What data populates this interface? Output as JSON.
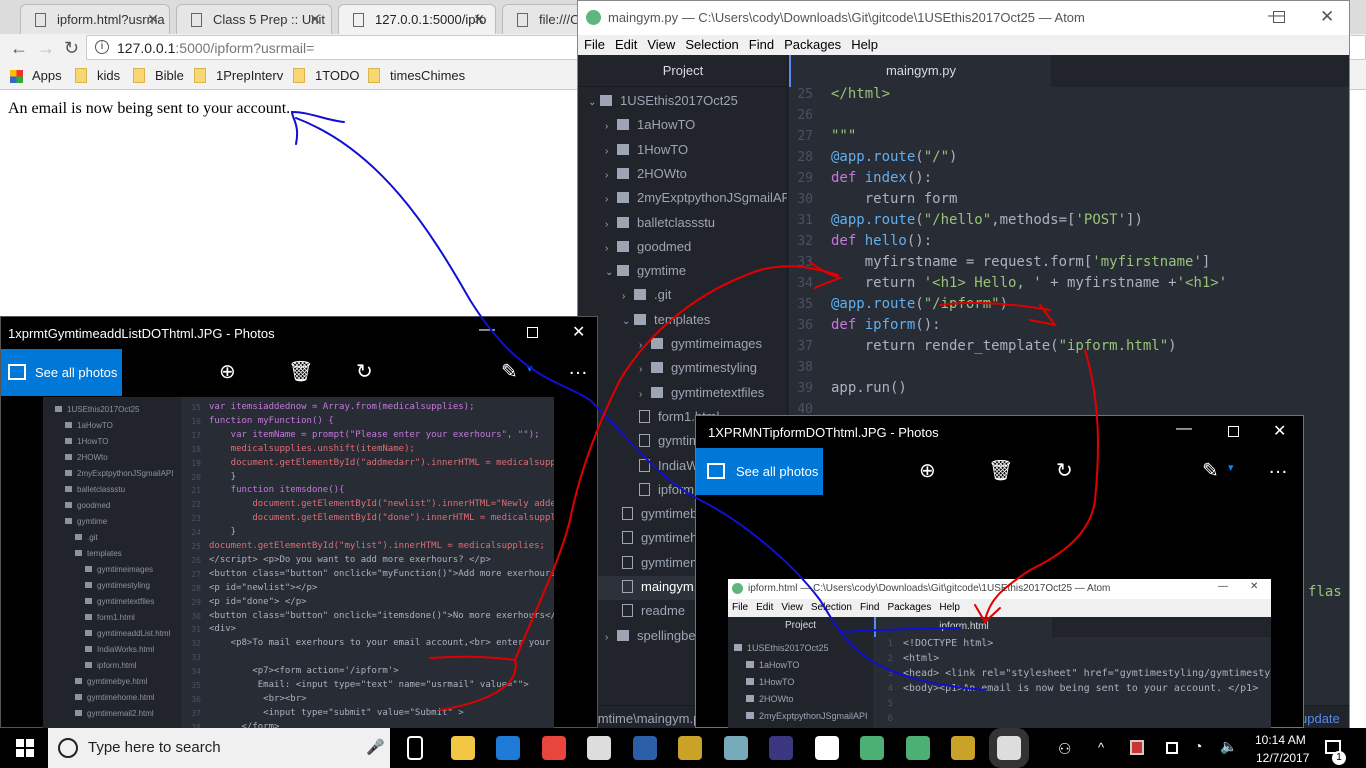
{
  "browser": {
    "tabs": [
      {
        "label": "ipform.html?usrma",
        "active": false
      },
      {
        "label": "Class 5 Prep :: Unit",
        "active": false
      },
      {
        "label": "127.0.0.1:5000/ipfo",
        "active": true
      },
      {
        "label": "file:///C:/ip",
        "active": false
      }
    ],
    "url_host": "127.0.0.1",
    "url_rest": ":5000/ipform?usrmail=",
    "bookmarks": [
      "Apps",
      "kids",
      "Bible",
      "1PrepInterv",
      "1TODO",
      "timesChimes"
    ],
    "page_text": "An email is now being sent to your account."
  },
  "atom_main": {
    "title": "maingym.py — C:\\Users\\cody\\Downloads\\Git\\gitcode\\1USEthis2017Oct25 — Atom",
    "menu": [
      "File",
      "Edit",
      "View",
      "Selection",
      "Find",
      "Packages",
      "Help"
    ],
    "panel_title": "Project",
    "tab": "maingym.py",
    "tree": [
      {
        "label": "1USEthis2017Oct25",
        "type": "folder",
        "open": true,
        "depth": 0
      },
      {
        "label": "1aHowTO",
        "type": "folder",
        "depth": 1
      },
      {
        "label": "1HowTO",
        "type": "folder",
        "depth": 1
      },
      {
        "label": "2HOWto",
        "type": "folder",
        "depth": 1
      },
      {
        "label": "2myExptpythonJSgmailAPI",
        "type": "folder",
        "depth": 1
      },
      {
        "label": "balletclassstu",
        "type": "folder",
        "depth": 1
      },
      {
        "label": "goodmed",
        "type": "folder",
        "depth": 1
      },
      {
        "label": "gymtime",
        "type": "folder",
        "open": true,
        "depth": 1
      },
      {
        "label": ".git",
        "type": "folder",
        "depth": 2
      },
      {
        "label": "templates",
        "type": "folder",
        "open": true,
        "depth": 2
      },
      {
        "label": "gymtimeimages",
        "type": "folder",
        "depth": 3
      },
      {
        "label": "gymtimestyling",
        "type": "folder",
        "depth": 3
      },
      {
        "label": "gymtimetextfiles",
        "type": "folder",
        "depth": 3
      },
      {
        "label": "form1.html",
        "type": "file",
        "depth": 3
      },
      {
        "label": "gymtimeaddList.html",
        "type": "file",
        "depth": 3
      },
      {
        "label": "IndiaWorks.html",
        "type": "file",
        "depth": 3
      },
      {
        "label": "ipform.html",
        "type": "file",
        "depth": 3
      },
      {
        "label": "gymtimebye.html",
        "type": "file",
        "depth": 2
      },
      {
        "label": "gymtimehome.html",
        "type": "file",
        "depth": 2
      },
      {
        "label": "gymtimemail2.html",
        "type": "file",
        "depth": 2
      },
      {
        "label": "maingym.py",
        "type": "file",
        "depth": 2,
        "selected": true
      },
      {
        "label": "readme",
        "type": "file",
        "depth": 2
      },
      {
        "label": "spellingbee",
        "type": "folder",
        "depth": 1
      }
    ],
    "code_lines": [
      {
        "n": "25",
        "tokens": [
          [
            "s",
            "</html>"
          ]
        ]
      },
      {
        "n": "26",
        "tokens": []
      },
      {
        "n": "27",
        "tokens": [
          [
            "s",
            "\"\"\""
          ]
        ]
      },
      {
        "n": "28",
        "tokens": [
          [
            "f",
            "@app.route"
          ],
          [
            "p",
            "("
          ],
          [
            "s",
            "\"/\""
          ],
          [
            "p",
            ")"
          ]
        ]
      },
      {
        "n": "29",
        "tokens": [
          [
            "k",
            "def "
          ],
          [
            "f",
            "index"
          ],
          [
            "p",
            "():"
          ]
        ]
      },
      {
        "n": "30",
        "tokens": [
          [
            "p",
            "    return form"
          ]
        ]
      },
      {
        "n": "31",
        "tokens": [
          [
            "f",
            "@app.route"
          ],
          [
            "p",
            "("
          ],
          [
            "s",
            "\"/hello\""
          ],
          [
            "p",
            ",methods=["
          ],
          [
            "s",
            "'POST'"
          ],
          [
            "p",
            "])"
          ]
        ]
      },
      {
        "n": "32",
        "tokens": [
          [
            "k",
            "def "
          ],
          [
            "f",
            "hello"
          ],
          [
            "p",
            "():"
          ]
        ]
      },
      {
        "n": "33",
        "tokens": [
          [
            "p",
            "    myfirstname = request.form["
          ],
          [
            "s",
            "'myfirstname'"
          ],
          [
            "p",
            "]"
          ]
        ]
      },
      {
        "n": "34",
        "tokens": [
          [
            "p",
            "    return "
          ],
          [
            "s",
            "'<h1> Hello, '"
          ],
          [
            "p",
            " + myfirstname +"
          ],
          [
            "s",
            "'<h1>'"
          ]
        ]
      },
      {
        "n": "35",
        "tokens": [
          [
            "f",
            "@app.route"
          ],
          [
            "p",
            "("
          ],
          [
            "s",
            "\"/ipform\""
          ],
          [
            "p",
            ")"
          ]
        ]
      },
      {
        "n": "36",
        "tokens": [
          [
            "k",
            "def "
          ],
          [
            "f",
            "ipform"
          ],
          [
            "p",
            "():"
          ]
        ]
      },
      {
        "n": "37",
        "tokens": [
          [
            "p",
            "    return render_template("
          ],
          [
            "s",
            "\"ipform.html\""
          ],
          [
            "p",
            ")"
          ]
        ]
      },
      {
        "n": "38",
        "tokens": []
      },
      {
        "n": "39",
        "tokens": [
          [
            "p",
            "app.run()"
          ]
        ]
      },
      {
        "n": "40",
        "tokens": []
      }
    ],
    "partial_code": "flas",
    "status_path": "gymtime\\maingym.py",
    "status_right": "update"
  },
  "photos1": {
    "title": "1xprmtGymtimeaddListDOThtml.JPG - Photos",
    "see_all": "See all photos",
    "tree": [
      "1USEthis2017Oct25",
      "1aHowTO",
      "1HowTO",
      "2HOWto",
      "2myExptpythonJSgmailAPI",
      "balletclassstu",
      "goodmed",
      "gymtime",
      ".git",
      "templates",
      "gymtimeimages",
      "gymtimestyling",
      "gymtimetextfiles",
      "form1.html",
      "gymtimeaddList.html",
      "IndiaWorks.html",
      "ipform.html",
      "gymtimebye.html",
      "gymtimehome.html",
      "gymtimemail2.html"
    ],
    "code_lines": [
      {
        "n": "15",
        "text": "var itemsiaddednow = Array.from(medicalsupplies);"
      },
      {
        "n": "16",
        "text": "function myFunction() {"
      },
      {
        "n": "17",
        "text": "    var itemName = prompt(\"Please enter your exerhours\", \"\");"
      },
      {
        "n": "18",
        "text": "    medicalsupplies.unshift(itemName);"
      },
      {
        "n": "19",
        "text": "    document.getElementById(\"addmedarr\").innerHTML = medicalsuppli"
      },
      {
        "n": "20",
        "text": "    }"
      },
      {
        "n": "21",
        "text": "    function itemsdone(){"
      },
      {
        "n": "22",
        "text": "        document.getElementById(\"newlist\").innerHTML=\"Newly added"
      },
      {
        "n": "23",
        "text": "        document.getElementById(\"done\").innerHTML = medicalsupplie"
      },
      {
        "n": "24",
        "text": "    }"
      },
      {
        "n": "25",
        "text": "document.getElementById(\"mylist\").innerHTML = medicalsupplies;"
      },
      {
        "n": "26",
        "text": "</script> <p>Do you want to add more exerhours? </p>"
      },
      {
        "n": "27",
        "text": "<button class=\"button\" onclick=\"myFunction()\">Add more exerhours</"
      },
      {
        "n": "28",
        "text": "<p id=\"newlist\"></p>"
      },
      {
        "n": "29",
        "text": "<p id=\"done\"> </p>"
      },
      {
        "n": "30",
        "text": "<button class=\"button\" onclick=\"itemsdone()\">No more exerhours</bu"
      },
      {
        "n": "31",
        "text": "<div>"
      },
      {
        "n": "32",
        "text": "    <p8>To mail exerhours to your email account,<br> enter your em"
      },
      {
        "n": "33",
        "text": ""
      },
      {
        "n": "34",
        "text": "        <p7><form action='/ipform'>"
      },
      {
        "n": "35",
        "text": "         Email: <input type=\"text\" name=\"usrmail\" value=\"\">"
      },
      {
        "n": "36",
        "text": "          <br><br>"
      },
      {
        "n": "37",
        "text": "          <input type=\"submit\" value=\"Submit\" >"
      },
      {
        "n": "38",
        "text": "      </form>"
      }
    ]
  },
  "photos2": {
    "title": "1XPRMNTipformDOThtml.JPG - Photos",
    "see_all": "See all photos",
    "inner_title": "ipform.html — C:\\Users\\cody\\Downloads\\Git\\gitcode\\1USEthis2017Oct25 — Atom",
    "inner_menu": [
      "File",
      "Edit",
      "View",
      "Selection",
      "Find",
      "Packages",
      "Help"
    ],
    "inner_panel": "Project",
    "inner_tab": "ipform.html",
    "inner_tree": [
      "1USEthis2017Oct25",
      "1aHowTO",
      "1HowTO",
      "2HOWto",
      "2myExptpythonJSgmailAPI"
    ],
    "code_lines": [
      {
        "n": "1",
        "text": "<!DOCTYPE html>"
      },
      {
        "n": "2",
        "text": "<html>"
      },
      {
        "n": "3",
        "text": "<head> <link rel=\"stylesheet\" href=\"gymtimestyling/gymtimestyle2.css"
      },
      {
        "n": "4",
        "text": "<body><p1>An email is now being sent to your account. </p1>"
      },
      {
        "n": "5",
        "text": ""
      },
      {
        "n": "6",
        "text": ""
      }
    ]
  },
  "taskbar": {
    "search_placeholder": "Type here to search",
    "apps": [
      "task-view",
      "file-explorer",
      "edge",
      "chrome",
      "paint",
      "powershell",
      "git-gui",
      "notepad",
      "eclipse",
      "mail",
      "atom",
      "atom",
      "git-gui",
      "photos"
    ],
    "time": "10:14 AM",
    "date": "12/7/2017",
    "notification_count": "1"
  },
  "colors": {
    "accent": "#0078d7",
    "annotation_red": "#e00000",
    "annotation_blue": "#1010d0"
  }
}
